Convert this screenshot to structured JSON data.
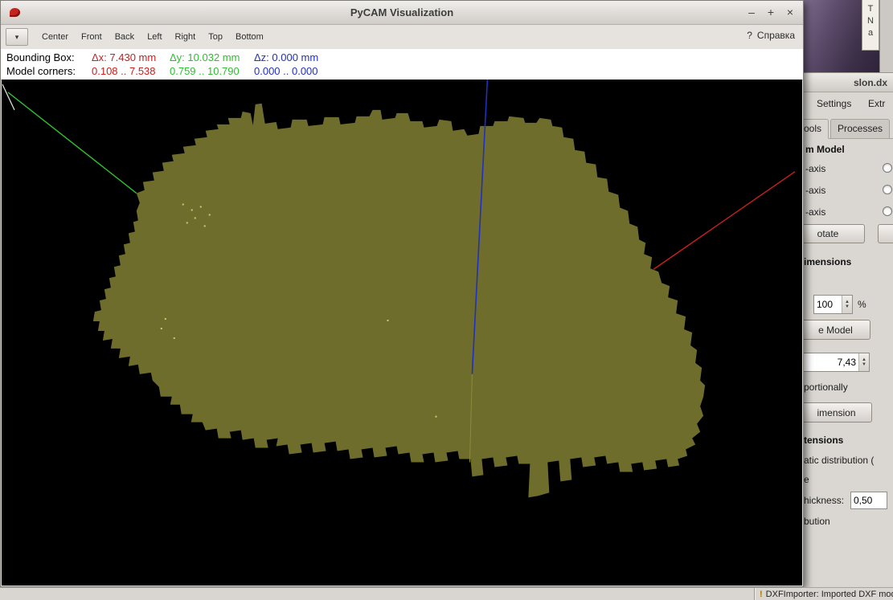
{
  "window": {
    "title": "PyCAM Visualization",
    "minimize": "–",
    "maximize": "+",
    "close": "×"
  },
  "toolbar": {
    "dropdown_icon": "▾",
    "view_buttons": [
      "Center",
      "Front",
      "Back",
      "Left",
      "Right",
      "Top",
      "Bottom"
    ],
    "help_icon": "?",
    "help_label": "Справка"
  },
  "infobar": {
    "bounding_box_label": "Bounding Box:",
    "dx": "Δx: 7.430 mm",
    "dy": "Δy: 10.032 mm",
    "dz": "Δz: 0.000 mm",
    "corners_label": "Model corners:",
    "x_range": "0.108 .. 7.538",
    "y_range": "0.759 .. 10.790",
    "z_range": "0.000 .. 0.000"
  },
  "right_panel": {
    "title": "slon.dx",
    "menu": [
      "Settings",
      "Extr"
    ],
    "tabs": [
      "ools",
      "Processes"
    ],
    "model_section": "m Model",
    "axis_rows": [
      "-axis",
      "-axis",
      "-axis"
    ],
    "rotate_button": "otate",
    "dimensions_section": "imensions",
    "scale_percent": "100",
    "percent_sign": "%",
    "scale_model_button": "e Model",
    "dimension_value": "7,43",
    "proportionally_label": "portionally",
    "dimension_button": "imension",
    "extensions_section": "tensions",
    "distribution_label": "atic distribution (",
    "edge_label": "e",
    "thickness_label": "hickness:",
    "thickness_value": "0,50",
    "distribution_label2": "bution"
  },
  "statusbar": {
    "warning": "!",
    "message": "DXFImporter: Imported DXF mode"
  },
  "desktop": {
    "vertical_letters": [
      "T",
      "N",
      "a"
    ]
  },
  "colors": {
    "x_axis": "#c62020",
    "y_axis": "#2fbe2f",
    "z_axis": "#2030c0",
    "model": "#6f6d2b"
  }
}
